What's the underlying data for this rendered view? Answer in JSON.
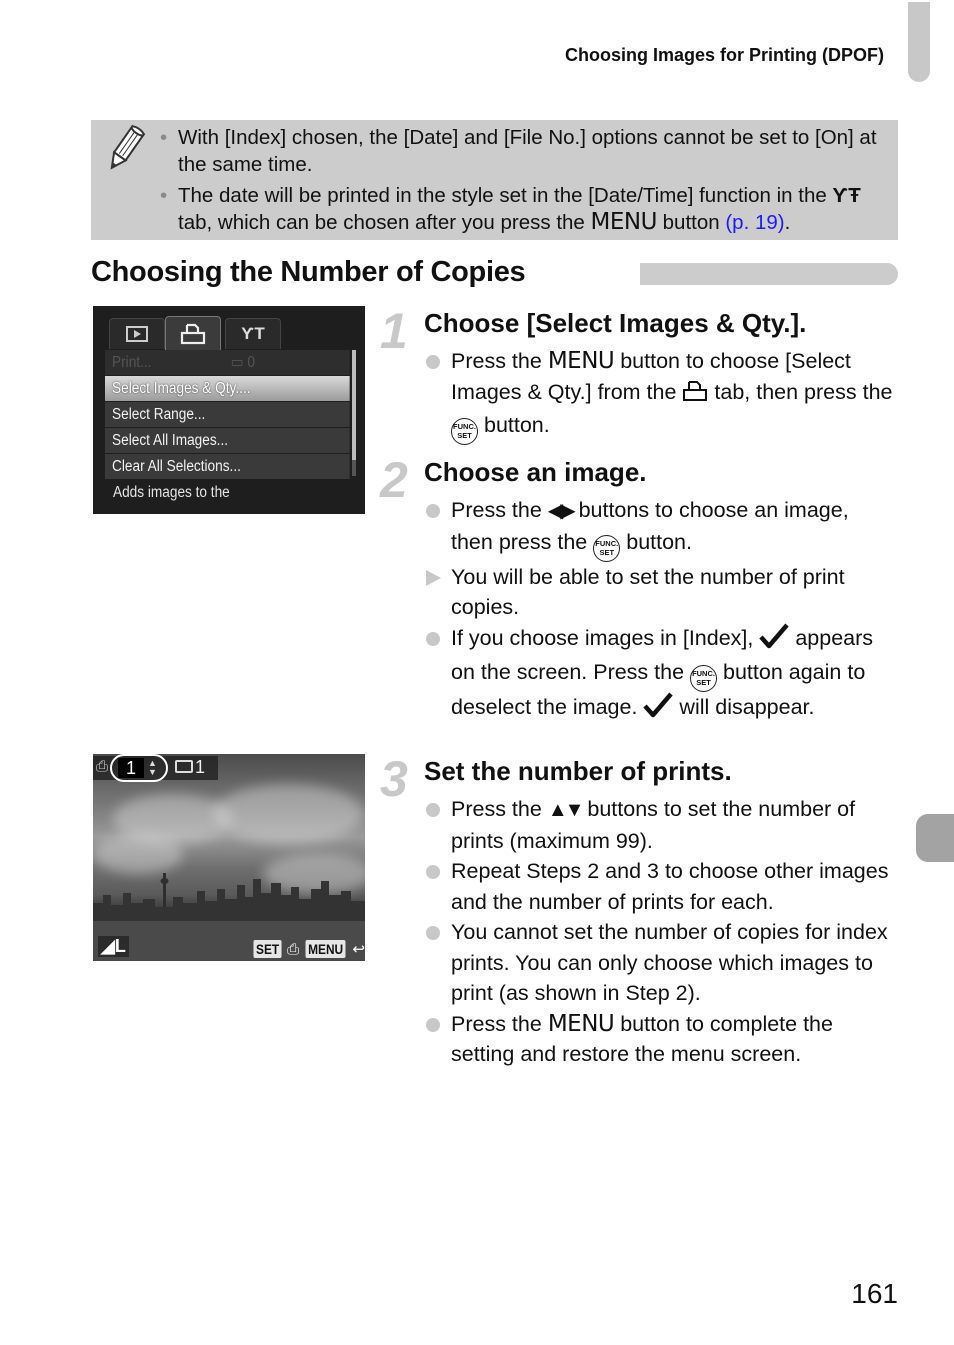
{
  "running_head": "Choosing Images for Printing (DPOF)",
  "note": {
    "icon": "pencil-icon",
    "items": [
      {
        "text": "With [Index] chosen, the [Date] and [File No.] options cannot be set to [On] at the same time."
      },
      {
        "text_before": "The date will be printed in the style set in the [Date/Time] function in the",
        "tab_icon": "settings-tab-icon",
        "text_middle": "tab, which can be chosen after you press the",
        "menu_label": "MENU",
        "text_after": "button",
        "link": "(p. 19)",
        "end": "."
      }
    ]
  },
  "section_title": "Choosing the Number of Copies",
  "camera_menu": {
    "tabs": [
      {
        "icon": "playback-tab-icon",
        "glyph": "▶",
        "active": false
      },
      {
        "icon": "print-tab-icon",
        "glyph": "⎙",
        "active": true
      },
      {
        "icon": "settings-tab-icon",
        "glyph": "ƳT",
        "active": false
      }
    ],
    "items": [
      {
        "label": "Print...",
        "value": "0",
        "state": "disabled"
      },
      {
        "label": "Select Images & Qty....",
        "state": "selected"
      },
      {
        "label": "Select Range...",
        "state": "normal"
      },
      {
        "label": "Select All Images...",
        "state": "normal"
      },
      {
        "label": "Clear All Selections...",
        "state": "normal"
      }
    ],
    "help_text": "Adds images to the"
  },
  "camera_photo": {
    "print_qty": "1",
    "sheet_count": "1",
    "image_size": "L",
    "buttons": {
      "set": "SET",
      "menu": "MENU"
    }
  },
  "steps": [
    {
      "number": "1",
      "title": "Choose [Select Images & Qty.].",
      "bullets": [
        {
          "marker": "circle",
          "parts": {
            "a": "Press the",
            "menu": "MENU",
            "b": "button to choose [Select Images & Qty.] from the",
            "c": "tab, then press the",
            "d": "button."
          }
        }
      ]
    },
    {
      "number": "2",
      "title": "Choose an image.",
      "bullets": [
        {
          "marker": "circle",
          "parts": {
            "a": "Press the",
            "arrows": "◀▶",
            "b": "buttons to choose an image, then press the",
            "c": "button."
          }
        },
        {
          "marker": "triangle",
          "text": "You will be able to set the number of print copies."
        },
        {
          "marker": "circle",
          "parts": {
            "a": "If you choose images in [Index],",
            "b": "appears on the screen. Press the",
            "c": "button again to deselect the image.",
            "d": "will disappear."
          }
        }
      ]
    },
    {
      "number": "3",
      "title": "Set the number of prints.",
      "bullets": [
        {
          "marker": "circle",
          "parts": {
            "a": "Press the",
            "arrows": "▲▼",
            "b": "buttons to set the number of prints (maximum 99)."
          }
        },
        {
          "marker": "circle",
          "text": "Repeat Steps 2 and 3 to choose other images and the number of prints for each."
        },
        {
          "marker": "circle",
          "text": "You cannot set the number of copies for index prints. You can only choose which images to print (as shown in Step 2)."
        },
        {
          "marker": "circle",
          "parts": {
            "a": "Press the",
            "menu": "MENU",
            "b": "button to complete the setting and restore the menu screen."
          }
        }
      ]
    }
  ],
  "func_button": {
    "line1": "FUNC.",
    "line2": "SET"
  },
  "page_number": "161",
  "colors": {
    "note_bg": "#cccccc",
    "link": "#1a1aff",
    "step_number": "#c8c8c8",
    "chapter_tab": "#a3a3a3"
  }
}
